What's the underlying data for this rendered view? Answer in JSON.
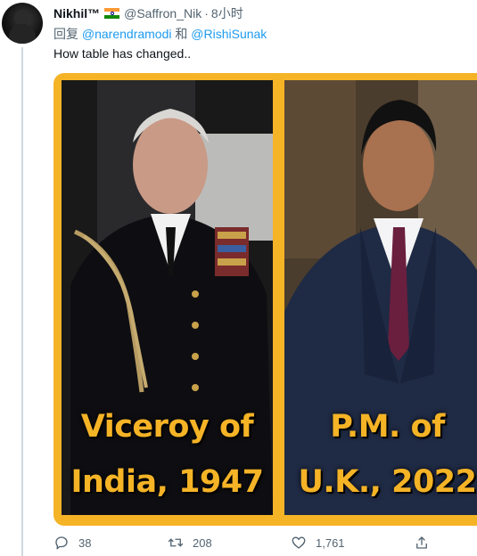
{
  "tweet": {
    "author_name": "Nikhil™",
    "flag_icon": "india-flag-icon",
    "handle": "@Saffron_Nik",
    "separator": "·",
    "time": "8小时",
    "reply_prefix": "回复",
    "reply_mention_1": "@narendramodi",
    "reply_conjunction": "和",
    "reply_mention_2": "@RishiSunak",
    "text": "How table has changed.."
  },
  "media": {
    "left_caption_line1": "Viceroy of",
    "left_caption_line2": "India, 1947",
    "right_caption_line1": "P.M. of",
    "right_caption_line2": "U.K., 2022",
    "frame_color": "#f5b326"
  },
  "actions": {
    "reply_count": "38",
    "retweet_count": "208",
    "like_count": "1,761"
  },
  "colors": {
    "link": "#1d9bf0",
    "secondary_text": "#536471",
    "primary_text": "#0f1419"
  }
}
